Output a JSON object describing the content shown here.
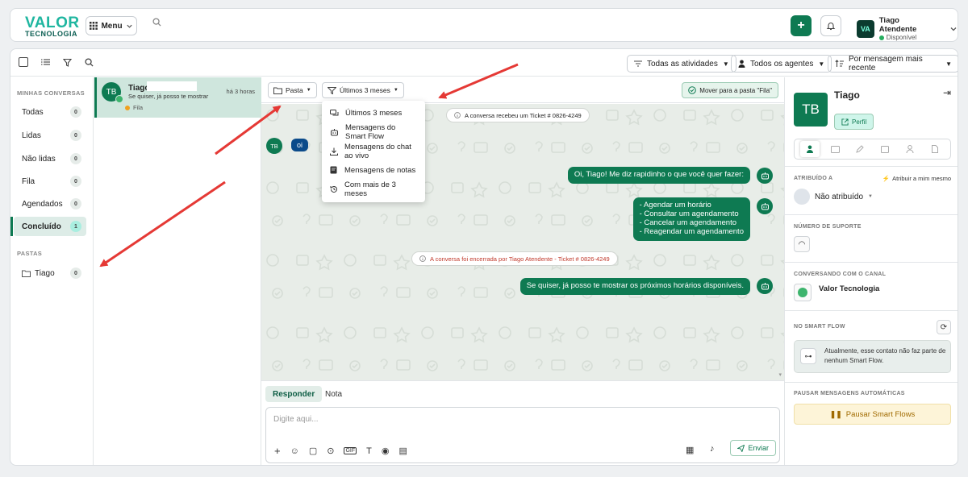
{
  "topbar": {
    "logo_line1": "VALOR",
    "logo_line2": "TECNOLOGIA",
    "menu_label": "Menu",
    "user_name": "Tiago Atendente",
    "user_status": "Disponível",
    "user_avatar": "VA"
  },
  "toolbar": {
    "filter_activities": "Todas as atividades",
    "filter_agents": "Todos os agentes",
    "filter_sort": "Por mensagem mais recente"
  },
  "sidebar": {
    "section_conversations": "MINHAS CONVERSAS",
    "items": [
      {
        "label": "Todas",
        "count": "0"
      },
      {
        "label": "Lidas",
        "count": "0"
      },
      {
        "label": "Não lidas",
        "count": "0"
      },
      {
        "label": "Fila",
        "count": "0"
      },
      {
        "label": "Agendados",
        "count": "0"
      },
      {
        "label": "Concluído",
        "count": "1"
      }
    ],
    "section_folders": "PASTAS",
    "folders": [
      {
        "label": "Tiago",
        "count": "0"
      }
    ]
  },
  "conversation": {
    "initials": "TB",
    "name": "Tiago",
    "preview": "Se quiser, já posso te mostrar",
    "time": "há 3 horas",
    "tag": "Fila"
  },
  "chat": {
    "folder_chip": "Pasta",
    "period_chip": "Últimos 3 meses",
    "move_button": "Mover para a pasta \"Fila\"",
    "dropdown": [
      {
        "icon": "messages-icon",
        "label": "Últimos 3 meses"
      },
      {
        "icon": "robot-icon",
        "label": "Mensagens do Smart Flow"
      },
      {
        "icon": "download-icon",
        "label": "Mensagens do chat ao vivo"
      },
      {
        "icon": "notes-icon",
        "label": "Mensagens de notas"
      },
      {
        "icon": "history-icon",
        "label": "Com mais de 3 meses"
      }
    ],
    "sys_ticket": "A conversa recebeu um Ticket # 0826-4249",
    "user_initials": "TB",
    "user_msg": "oi",
    "bot_msg1": "Oi, Tiago! Me diz rapidinho o que você quer fazer:",
    "bot_options": [
      "- Agendar um horário",
      "- Consultar um agendamento",
      "- Cancelar um agendamento",
      "- Reagendar um agendamento"
    ],
    "sys_closed": "A conversa foi encerrada por Tiago Atendente - Ticket # 0826-4249",
    "bot_msg3": "Se quiser, já posso te mostrar os próximos horários disponíveis."
  },
  "composer": {
    "tab_reply": "Responder",
    "tab_note": "Nota",
    "placeholder": "Digite aqui...",
    "send_label": "Enviar"
  },
  "right_panel": {
    "initials": "TB",
    "name": "Tiago",
    "profile_button": "Perfil",
    "assigned_title": "ATRIBUÍDO A",
    "assign_me": "Atribuir a mim mesmo",
    "assigned_value": "Não atribuído",
    "support_title": "NÚMERO DE SUPORTE",
    "channel_title": "CONVERSANDO COM O CANAL",
    "channel_name": "Valor Tecnologia",
    "smartflow_title": "NO SMART FLOW",
    "smartflow_text": "Atualmente, esse contato não faz parte de nenhum Smart Flow.",
    "pause_title": "PAUSAR MENSAGENS AUTOMÁTICAS",
    "pause_button": "Pausar Smart Flows"
  },
  "colors": {
    "primary": "#0e7a52",
    "accent": "#1fb6a0",
    "arrow": "#e53935"
  }
}
